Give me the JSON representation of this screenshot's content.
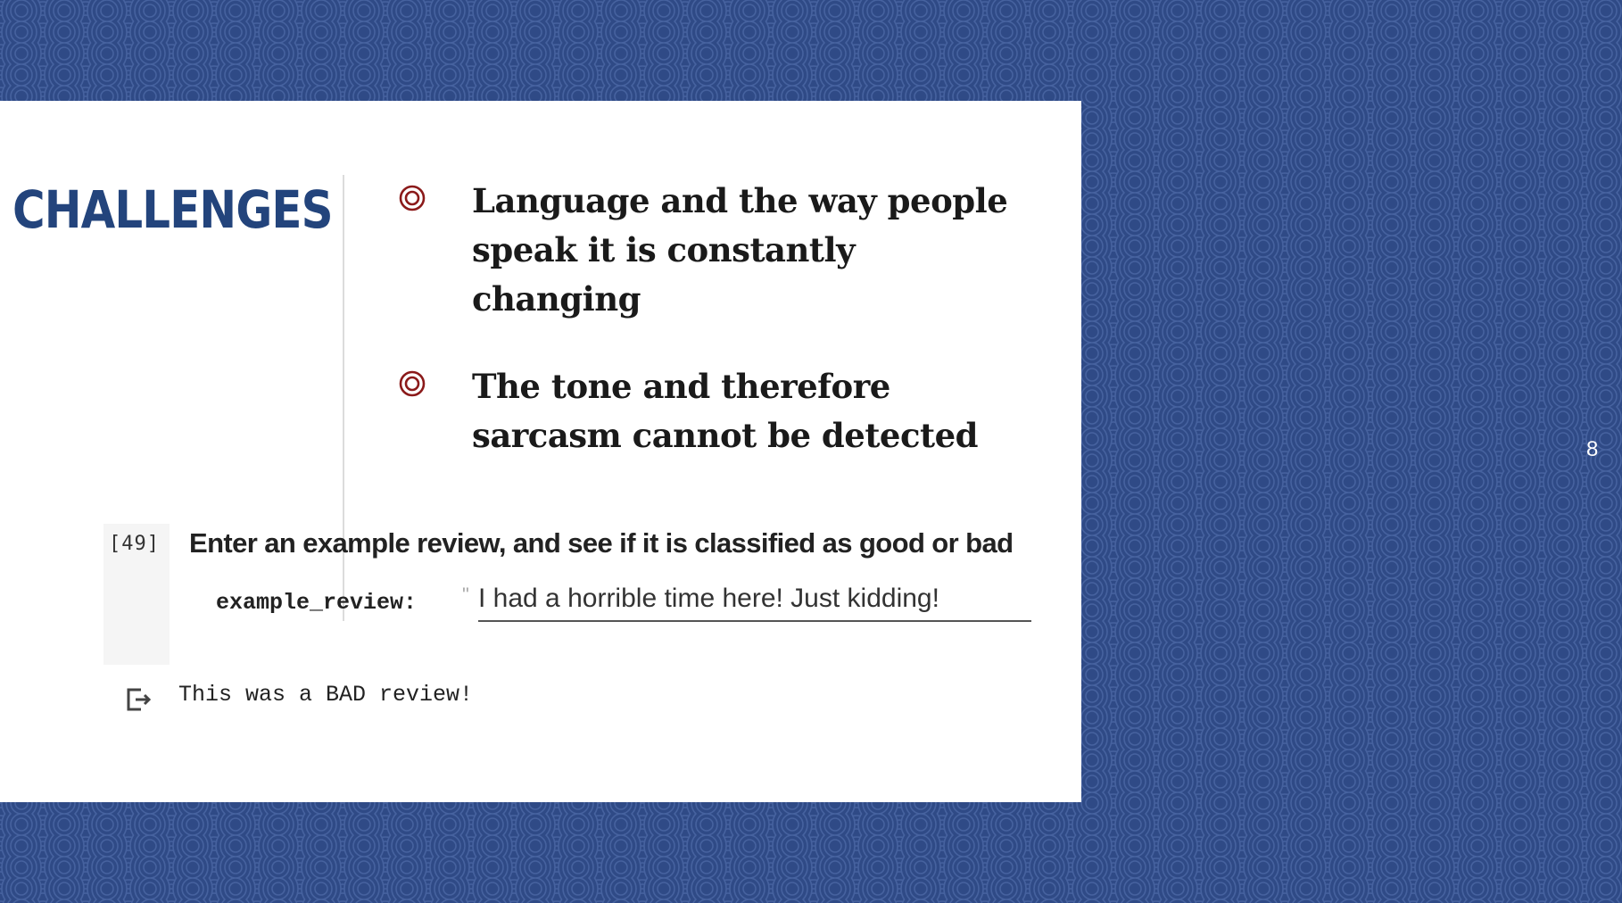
{
  "slide": {
    "title": "CHALLENGES",
    "page_number": "8",
    "bullets": [
      {
        "icon": "double-ring-bullet-icon",
        "text": "Language and the way people speak it is constantly changing"
      },
      {
        "icon": "double-ring-bullet-icon",
        "text": "The tone and therefore sarcasm cannot be detected"
      }
    ],
    "colors": {
      "background": "#2f4a86",
      "title": "#23447c",
      "bullet_icon": "#8b1a1a",
      "card": "#ffffff"
    }
  },
  "notebook": {
    "cell_number": "[49]",
    "heading": "Enter an example review, and see if it is classified as good or bad",
    "param_label": "example_review:",
    "quote_mark": "\"",
    "input_value": "I had a horrible time here! Just kidding!",
    "output_icon": "output-arrow-icon",
    "output_text": "This was a BAD review!"
  }
}
